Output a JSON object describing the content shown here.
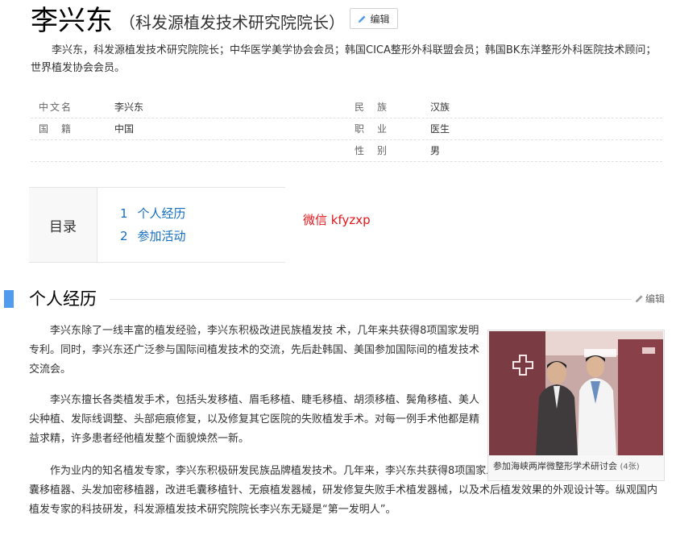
{
  "header": {
    "name": "李兴东",
    "subtitle": "（科发源植发技术研究院院长）",
    "edit_label": "编辑"
  },
  "summary": "李兴东，科发源植发技术研究院院长；中华医学美学协会会员；韩国CICA整形外科联盟会员；韩国BK东洋整形外科医院技术顾问；世界植发协会会员。",
  "basic_info": [
    {
      "left_label": "中文名",
      "left_value": "李兴东",
      "right_label": "民　族",
      "right_value": "汉族"
    },
    {
      "left_label": "国　籍",
      "left_value": "中国",
      "right_label": "职　业",
      "right_value": "医生"
    },
    {
      "left_label": "",
      "left_value": "",
      "right_label": "性　别",
      "right_value": "男"
    }
  ],
  "toc": {
    "heading": "目录",
    "items": [
      {
        "num": "1",
        "label": "个人经历"
      },
      {
        "num": "2",
        "label": "参加活动"
      }
    ]
  },
  "wechat": "微信 kfyzxp",
  "section": {
    "title": "个人经历",
    "edit_label": "编辑",
    "paragraphs": [
      "李兴东除了一线丰富的植发经验，李兴东积极改进民族植发技 术，几年来共获得8项国家发明专利。同时，李兴东还广泛参与国际间植发技术的交流，先后赴韩国、美国参加国际间的植发技术交流会。",
      "李兴东擅长各类植发手术，包括头发移植、眉毛移植、睫毛移植、胡须移植、鬓角移植、美人尖种植、发际线调整、头部疤痕修复，以及修复其它医院的失败植发手术。对每一例手术他都是精益求精，许多患者经他植发整个面貌焕然一新。",
      "作为业内的知名植发专家，李兴东积极研发民族品牌植发技术。几年来，李兴东共获得8项国家发明专利，这些专利包括创新自体毛囊移植器、头发加密移植器，改进毛囊移植针、无痕植发器械，研发修复失败手术植发器械，以及术后植发效果的外观设计等。纵观国内植发专家的科技研发，科发源植发技术研究院院长李兴东无疑是“第一发明人”。"
    ]
  },
  "photo": {
    "caption": "参加海峡两岸微整形学术研讨会",
    "count": "(4张)"
  },
  "colors": {
    "link": "#136ec2",
    "accent": "#4f9cee",
    "wechat": "#e5161b"
  }
}
